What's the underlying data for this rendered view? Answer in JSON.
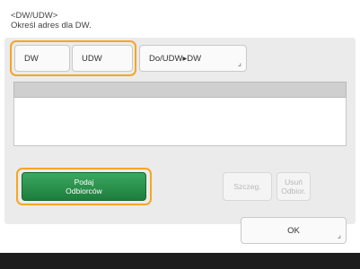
{
  "header": {
    "title": "<DW/UDW>",
    "instruction": "Określ adres dla DW."
  },
  "tabs": [
    {
      "label": "DW"
    },
    {
      "label": "UDW"
    },
    {
      "label": "Do/UDW▸DW",
      "corner": "⌟"
    }
  ],
  "actions": {
    "specify_line1": "Podaj",
    "specify_line2": "Odbiorców",
    "details_label": "Szczeg.",
    "remove_line1": "Usuń",
    "remove_line2": "Odbior.",
    "ok_label": "OK",
    "ok_corner": "⌟"
  },
  "colors": {
    "highlight": "#f5a623",
    "primary": "#1e7d3d"
  }
}
